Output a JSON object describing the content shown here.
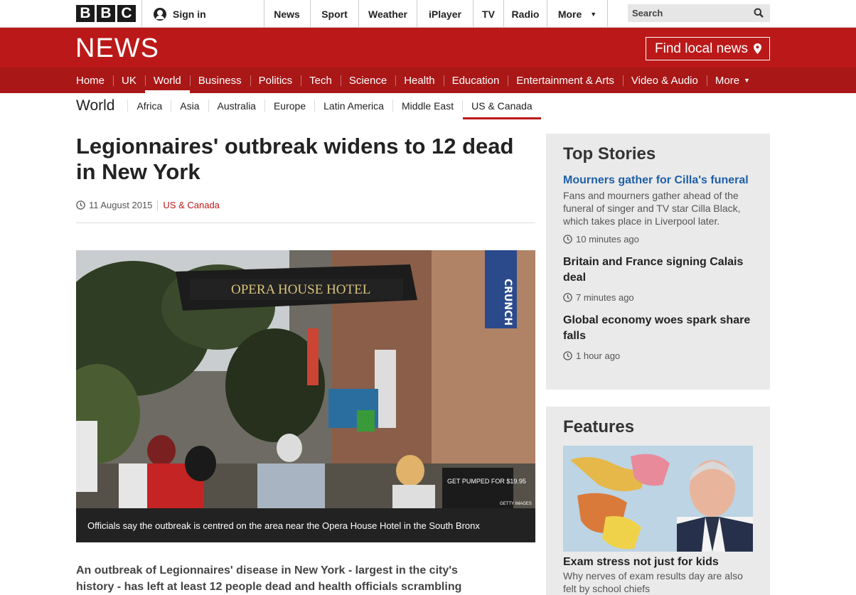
{
  "topbar": {
    "logo_letters": [
      "B",
      "B",
      "C"
    ],
    "signin_label": "Sign in",
    "nav": [
      {
        "label": "News",
        "name": "news"
      },
      {
        "label": "Sport",
        "name": "sport"
      },
      {
        "label": "Weather",
        "name": "weather"
      },
      {
        "label": "iPlayer",
        "name": "iplayer"
      },
      {
        "label": "TV",
        "name": "tv"
      },
      {
        "label": "Radio",
        "name": "radio"
      },
      {
        "label": "More",
        "name": "more"
      }
    ],
    "search_placeholder": "Search"
  },
  "masthead": {
    "title": "NEWS",
    "find_local": "Find local news"
  },
  "section_nav": {
    "items": [
      "Home",
      "UK",
      "World",
      "Business",
      "Politics",
      "Tech",
      "Science",
      "Health",
      "Education",
      "Entertainment & Arts",
      "Video & Audio",
      "More"
    ],
    "active": "World"
  },
  "sub_nav": {
    "title": "World",
    "items": [
      "Africa",
      "Asia",
      "Australia",
      "Europe",
      "Latin America",
      "Middle East",
      "US & Canada"
    ],
    "active": "US & Canada"
  },
  "article": {
    "headline": "Legionnaires' outbreak widens to 12 dead in New York",
    "date": "11 August 2015",
    "section": "US & Canada",
    "image_caption": "Officials say the outbreak is centred on the area near the Opera House Hotel in the South Bronx",
    "image_credit": "GETTY IMAGES",
    "image_sign": "OPERA HOUSE HOTEL",
    "image_price_sign": "GET PUMPED FOR $19.95",
    "image_store_sign": "CRUNCH",
    "intro": "An outbreak of Legionnaires' disease in New York - largest in the city's history - has left at least 12 people dead and health officials scrambling to"
  },
  "top_stories": {
    "title": "Top Stories",
    "stories": [
      {
        "title": "Mourners gather for Cilla's funeral",
        "summary": "Fans and mourners gather ahead of the funeral of singer and TV star Cilla Black, which takes place in Liverpool later.",
        "time": "10 minutes ago"
      },
      {
        "title": "Britain and France signing Calais deal",
        "time": "7 minutes ago"
      },
      {
        "title": "Global economy woes spark share falls",
        "time": "1 hour ago"
      }
    ]
  },
  "features": {
    "title": "Features",
    "item_title": "Exam stress not just for kids",
    "item_summary": "Why nerves of exam results day are also felt by school chiefs"
  },
  "colors": {
    "brand_red": "#bb1919",
    "nav_red": "#a91717",
    "link_blue": "#1f5fa8"
  }
}
